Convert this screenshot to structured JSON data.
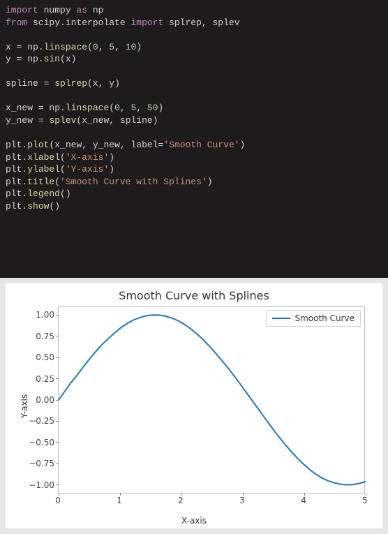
{
  "code": {
    "lines": [
      [
        [
          "kw-import",
          "import"
        ],
        [
          "id",
          " numpy "
        ],
        [
          "kw-as",
          "as"
        ],
        [
          "id",
          " np"
        ]
      ],
      [
        [
          "kw-from",
          "from"
        ],
        [
          "id",
          " scipy"
        ],
        [
          "pun",
          "."
        ],
        [
          "id",
          "interpolate "
        ],
        [
          "kw-import",
          "import"
        ],
        [
          "id",
          " splrep"
        ],
        [
          "pun",
          ","
        ],
        [
          "id",
          " splev"
        ]
      ],
      [],
      [
        [
          "id",
          "x "
        ],
        [
          "eq",
          "="
        ],
        [
          "id",
          " np"
        ],
        [
          "pun",
          "."
        ],
        [
          "func",
          "linspace"
        ],
        [
          "pun",
          "("
        ],
        [
          "num",
          "0"
        ],
        [
          "pun",
          ", "
        ],
        [
          "num",
          "5"
        ],
        [
          "pun",
          ", "
        ],
        [
          "num",
          "10"
        ],
        [
          "pun",
          ")"
        ]
      ],
      [
        [
          "id",
          "y "
        ],
        [
          "eq",
          "="
        ],
        [
          "id",
          " np"
        ],
        [
          "pun",
          "."
        ],
        [
          "func",
          "sin"
        ],
        [
          "pun",
          "("
        ],
        [
          "id",
          "x"
        ],
        [
          "pun",
          ")"
        ]
      ],
      [],
      [
        [
          "id",
          "spline "
        ],
        [
          "eq",
          "="
        ],
        [
          "id",
          " "
        ],
        [
          "func",
          "splrep"
        ],
        [
          "pun",
          "("
        ],
        [
          "id",
          "x"
        ],
        [
          "pun",
          ", "
        ],
        [
          "id",
          "y"
        ],
        [
          "pun",
          ")"
        ]
      ],
      [],
      [
        [
          "id",
          "x_new "
        ],
        [
          "eq",
          "="
        ],
        [
          "id",
          " np"
        ],
        [
          "pun",
          "."
        ],
        [
          "func",
          "linspace"
        ],
        [
          "pun",
          "("
        ],
        [
          "num",
          "0"
        ],
        [
          "pun",
          ", "
        ],
        [
          "num",
          "5"
        ],
        [
          "pun",
          ", "
        ],
        [
          "num",
          "50"
        ],
        [
          "pun",
          ")"
        ]
      ],
      [
        [
          "id",
          "y_new "
        ],
        [
          "eq",
          "="
        ],
        [
          "id",
          " "
        ],
        [
          "func",
          "splev"
        ],
        [
          "pun",
          "("
        ],
        [
          "id",
          "x_new"
        ],
        [
          "pun",
          ", "
        ],
        [
          "id",
          "spline"
        ],
        [
          "pun",
          ")"
        ]
      ],
      [],
      [
        [
          "id",
          "plt"
        ],
        [
          "pun",
          "."
        ],
        [
          "func",
          "plot"
        ],
        [
          "pun",
          "("
        ],
        [
          "id",
          "x_new"
        ],
        [
          "pun",
          ", "
        ],
        [
          "id",
          "y_new"
        ],
        [
          "pun",
          ", "
        ],
        [
          "id",
          "label"
        ],
        [
          "eq",
          "="
        ],
        [
          "str",
          "'Smooth Curve'"
        ],
        [
          "pun",
          ")"
        ]
      ],
      [
        [
          "id",
          "plt"
        ],
        [
          "pun",
          "."
        ],
        [
          "func",
          "xlabel"
        ],
        [
          "pun",
          "("
        ],
        [
          "str",
          "'X-axis'"
        ],
        [
          "pun",
          ")"
        ]
      ],
      [
        [
          "id",
          "plt"
        ],
        [
          "pun",
          "."
        ],
        [
          "func",
          "ylabel"
        ],
        [
          "pun",
          "("
        ],
        [
          "str",
          "'Y-axis'"
        ],
        [
          "pun",
          ")"
        ]
      ],
      [
        [
          "id",
          "plt"
        ],
        [
          "pun",
          "."
        ],
        [
          "func",
          "title"
        ],
        [
          "pun",
          "("
        ],
        [
          "str",
          "'Smooth Curve with Splines'"
        ],
        [
          "pun",
          ")"
        ]
      ],
      [
        [
          "id",
          "plt"
        ],
        [
          "pun",
          "."
        ],
        [
          "func",
          "legend"
        ],
        [
          "pun",
          "()"
        ]
      ],
      [
        [
          "id",
          "plt"
        ],
        [
          "pun",
          "."
        ],
        [
          "func",
          "show"
        ],
        [
          "pun",
          "()"
        ]
      ]
    ]
  },
  "chart_data": {
    "type": "line",
    "title": "Smooth Curve with Splines",
    "xlabel": "X-axis",
    "ylabel": "Y-axis",
    "xlim": [
      0,
      5
    ],
    "ylim": [
      -1.1,
      1.1
    ],
    "xticks": [
      0,
      1,
      2,
      3,
      4,
      5
    ],
    "yticks": [
      -1.0,
      -0.75,
      -0.5,
      -0.25,
      0.0,
      0.25,
      0.5,
      0.75,
      1.0
    ],
    "ytick_labels": [
      "−1.00",
      "−0.75",
      "−0.50",
      "−0.25",
      "0.00",
      "0.25",
      "0.50",
      "0.75",
      "1.00"
    ],
    "legend": {
      "position": "upper right",
      "entries": [
        "Smooth Curve"
      ]
    },
    "series": [
      {
        "name": "Smooth Curve",
        "color": "#1f77b4",
        "x": [
          0.0,
          0.1,
          0.2,
          0.31,
          0.41,
          0.51,
          0.61,
          0.71,
          0.82,
          0.92,
          1.02,
          1.12,
          1.22,
          1.33,
          1.43,
          1.53,
          1.63,
          1.73,
          1.84,
          1.94,
          2.04,
          2.14,
          2.24,
          2.35,
          2.45,
          2.55,
          2.65,
          2.76,
          2.86,
          2.96,
          3.06,
          3.16,
          3.27,
          3.37,
          3.47,
          3.57,
          3.67,
          3.78,
          3.88,
          3.98,
          4.08,
          4.18,
          4.29,
          4.39,
          4.49,
          4.59,
          4.69,
          4.8,
          4.9,
          5.0
        ],
        "y": [
          0.0,
          0.102,
          0.203,
          0.301,
          0.396,
          0.488,
          0.574,
          0.654,
          0.728,
          0.794,
          0.853,
          0.902,
          0.941,
          0.971,
          0.99,
          0.999,
          0.998,
          0.987,
          0.965,
          0.934,
          0.893,
          0.843,
          0.785,
          0.712,
          0.637,
          0.556,
          0.471,
          0.375,
          0.281,
          0.184,
          0.085,
          -0.015,
          -0.123,
          -0.224,
          -0.322,
          -0.417,
          -0.508,
          -0.6,
          -0.678,
          -0.75,
          -0.814,
          -0.869,
          -0.918,
          -0.951,
          -0.975,
          -0.99,
          -0.998,
          -0.994,
          -0.98,
          -0.959
        ]
      }
    ]
  }
}
